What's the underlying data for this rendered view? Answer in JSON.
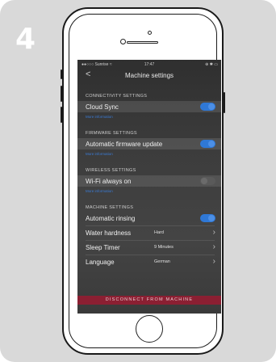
{
  "step_number": "4",
  "status_bar": {
    "carrier": "Sunrise",
    "time": "17:47"
  },
  "nav": {
    "back_symbol": "<",
    "title": "Machine settings"
  },
  "sections": {
    "connectivity": {
      "header": "CONNECTIVITY SETTINGS",
      "label": "Cloud Sync",
      "more": "More information",
      "toggle_on": true
    },
    "firmware": {
      "header": "FIRMWARE SETTINGS",
      "label": "Automatic firmware update",
      "more": "More information",
      "toggle_on": true
    },
    "wireless": {
      "header": "WIRELESS SETTINGS",
      "label": "Wi-Fi always on",
      "more": "More information",
      "toggle_on": false
    },
    "machine": {
      "header": "MACHINE SETTINGS",
      "rinsing_label": "Automatic rinsing",
      "rinsing_on": true,
      "hardness_label": "Water hardness",
      "hardness_value": "Hard",
      "sleep_label": "Sleep Timer",
      "sleep_value": "9 Minutes",
      "language_label": "Language",
      "language_value": "German"
    }
  },
  "disconnect_label": "DISCONNECT FROM MACHINE",
  "colors": {
    "accent_blue": "#2f78d6",
    "disconnect_red": "#8b1f32",
    "card_grey": "#d9d9d9"
  }
}
